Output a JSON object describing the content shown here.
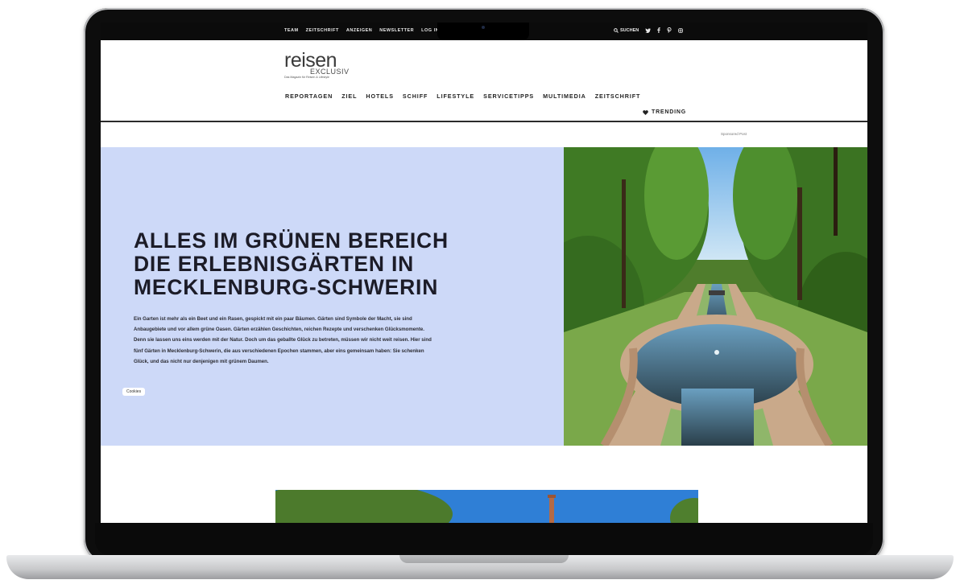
{
  "topbar": {
    "links": [
      "TEAM",
      "ZEITSCHRIFT",
      "ANZEIGEN",
      "NEWSLETTER",
      "LOG IN"
    ],
    "search_label": "SUCHEN",
    "social_icons": [
      "twitter-icon",
      "facebook-icon",
      "pinterest-icon",
      "instagram-icon"
    ]
  },
  "header": {
    "logo_main": "reisen",
    "logo_sub": "EXCLUSIV",
    "logo_tagline": "Das Magazin für Reisen & Lifestyle",
    "nav": [
      "REPORTAGEN",
      "ZIEL",
      "HOTELS",
      "SCHIFF",
      "LIFESTYLE",
      "SERVICETIPPS",
      "MULTIMEDIA",
      "ZEITSCHRIFT"
    ],
    "trending_label": "TRENDING",
    "sponsored_label": "Sponsored Post"
  },
  "hero": {
    "title_line1": "ALLES IM GRÜNEN BEREICH",
    "title_line2": "DIE ERLEBNISGÄRTEN IN",
    "title_line3": "MECKLENBURG-SCHWERIN",
    "text": "Ein Garten ist mehr als ein Beet und ein Rasen, gespickt mit ein paar Bäumen. Gärten sind Symbole der Macht, sie sind Anbaugebiete und vor allem grüne Oasen. Gärten erzählen Geschichten, reichen Rezepte und verschenken Glücksmomente. Denn sie lassen uns eins werden mit der Natur. Doch um das geballte Glück zu betreten, müssen wir nicht weit reisen. Hier sind fünf Gärten in Mecklenburg-Schwerin, die aus verschiedenen Epochen stammen, aber eins gemeinsam haben: Sie schenken Glück, und das nicht nur denjenigen mit grünem Daumen.",
    "cookies_label": "Cookies"
  },
  "colors": {
    "hero_bg": "#cdd9f8",
    "topbar_bg": "#0b0b0b",
    "text_dark": "#1c1c28"
  }
}
